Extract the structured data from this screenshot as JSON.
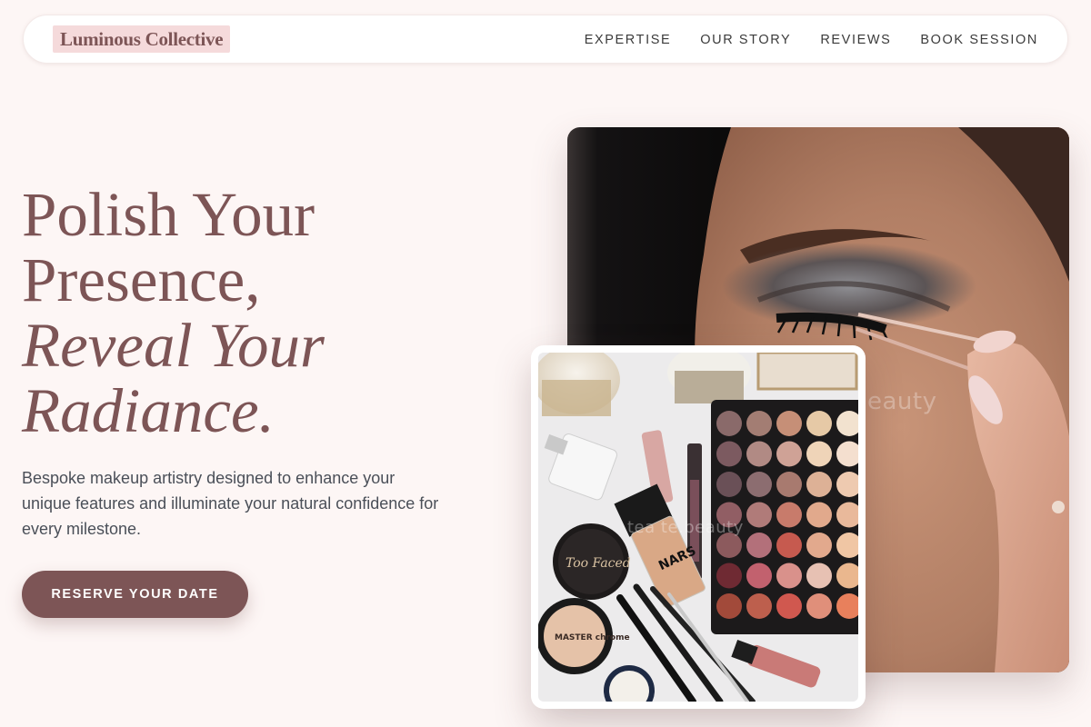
{
  "brand": {
    "name": "Luminous Collective"
  },
  "nav": {
    "items": [
      {
        "label": "EXPERTISE"
      },
      {
        "label": "OUR STORY"
      },
      {
        "label": "REVIEWS"
      },
      {
        "label": "BOOK SESSION"
      }
    ]
  },
  "hero": {
    "headline": {
      "line1": "Polish Your",
      "line2": "Presence,",
      "line3": "Reveal Your",
      "line4": "Radiance."
    },
    "subtext": "Bespoke makeup artistry designed to enhance your unique features and illuminate your natural confidence for every milestone.",
    "cta_label": "RESERVE YOUR DATE"
  },
  "images": {
    "main_watermark": "eauty",
    "flatlay_watermark": "tea   te.beauty",
    "jar1_text": "Too Faced",
    "compact_text": "MASTER chrome",
    "foundation_text": "NARS"
  },
  "colors": {
    "accent": "#7d5556",
    "background": "#fdf6f5",
    "logo_highlight": "#f5dadb"
  }
}
